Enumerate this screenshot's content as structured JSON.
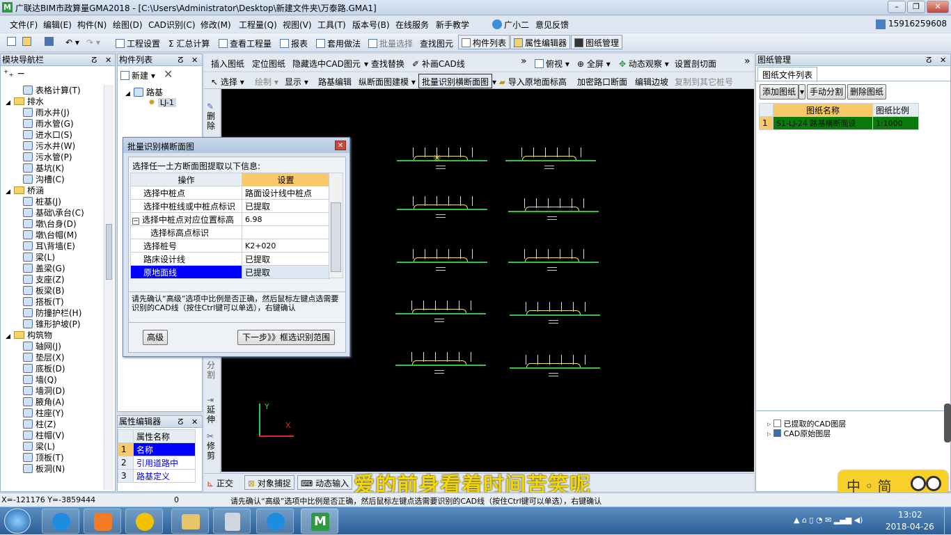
{
  "window": {
    "title": "广联达BIM市政算量GMA2018 - [C:\\Users\\Administrator\\Desktop\\新建文件夹\\万泰路.GMA1]",
    "min": "–",
    "restore": "❐",
    "close": "✕"
  },
  "menu": [
    "文件(F)",
    "编辑(E)",
    "构件(N)",
    "绘图(D)",
    "CAD识别(C)",
    "修改(M)",
    "工程量(Q)",
    "视图(V)",
    "工具(T)",
    "版本号(B)",
    "在线服务",
    "新手教学",
    "广小二",
    "意见反馈"
  ],
  "phone": "15916259608",
  "toolbar1": [
    "工程设置",
    "Σ 汇总计算",
    "查看工程量",
    "报表",
    "套用做法",
    "批量选择",
    "查找图元"
  ],
  "toggles": [
    "构件列表",
    "属性编辑器",
    "图纸管理"
  ],
  "nav_panel": {
    "title": "模块导航栏",
    "items": [
      {
        "label": "表格计算(T)",
        "level": 2
      },
      {
        "label": "排水",
        "level": 1,
        "folder": true
      },
      {
        "label": "雨水井(J)",
        "level": 2
      },
      {
        "label": "雨水管(G)",
        "level": 2
      },
      {
        "label": "进水口(S)",
        "level": 2
      },
      {
        "label": "污水井(W)",
        "level": 2
      },
      {
        "label": "污水管(P)",
        "level": 2
      },
      {
        "label": "基坑(K)",
        "level": 2
      },
      {
        "label": "沟槽(C)",
        "level": 2
      },
      {
        "label": "桥涵",
        "level": 1,
        "folder": true
      },
      {
        "label": "桩基(J)",
        "level": 2
      },
      {
        "label": "基础\\承台(C)",
        "level": 2
      },
      {
        "label": "墩\\台身(D)",
        "level": 2
      },
      {
        "label": "墩\\台帽(M)",
        "level": 2
      },
      {
        "label": "耳\\背墙(E)",
        "level": 2
      },
      {
        "label": "梁(L)",
        "level": 2
      },
      {
        "label": "盖梁(G)",
        "level": 2
      },
      {
        "label": "支座(Z)",
        "level": 2
      },
      {
        "label": "板梁(B)",
        "level": 2
      },
      {
        "label": "搭板(T)",
        "level": 2
      },
      {
        "label": "防撞护栏(H)",
        "level": 2
      },
      {
        "label": "锥形护坡(P)",
        "level": 2
      },
      {
        "label": "构筑物",
        "level": 1,
        "folder": true
      },
      {
        "label": "轴网(J)",
        "level": 2
      },
      {
        "label": "垫层(X)",
        "level": 2
      },
      {
        "label": "底板(D)",
        "level": 2
      },
      {
        "label": "墙(Q)",
        "level": 2
      },
      {
        "label": "墙洞(D)",
        "level": 2
      },
      {
        "label": "腋角(A)",
        "level": 2
      },
      {
        "label": "柱座(Y)",
        "level": 2
      },
      {
        "label": "柱(Z)",
        "level": 2
      },
      {
        "label": "柱帽(V)",
        "level": 2
      },
      {
        "label": "梁(L)",
        "level": 2
      },
      {
        "label": "顶板(T)",
        "level": 2
      },
      {
        "label": "板洞(N)",
        "level": 2
      }
    ]
  },
  "component_panel": {
    "title": "构件列表",
    "new_label": "新建",
    "tree_root": "路基",
    "tree_child": "LJ-1"
  },
  "attr_panel": {
    "title": "属性编辑器",
    "header": "属性名称",
    "rows": [
      {
        "num": "1",
        "name": "名称"
      },
      {
        "num": "2",
        "name": "引用道路中"
      },
      {
        "num": "3",
        "name": "路基定义"
      }
    ]
  },
  "side_tools": [
    "删除",
    "分割",
    "延伸",
    "修剪"
  ],
  "toolbar2": [
    "插入图纸",
    "定位图纸",
    "隐藏选中CAD图元",
    "查找替换",
    "补画CAD线",
    "俯视",
    "全屏",
    "动态观察",
    "设置剖切面"
  ],
  "toolbar3": [
    "选择",
    "绘制",
    "显示",
    "路基编辑",
    "纵断面图建模",
    "批量识别横断面图",
    "导入原地面标高",
    "加密路口断面",
    "编辑边坡",
    "复制到其它桩号"
  ],
  "dialog": {
    "title": "批量识别横断面图",
    "prompt": "选择任一土方断面图提取以下信息:",
    "col_op": "操作",
    "col_set": "设置",
    "rows": [
      {
        "op": "选择中桩点",
        "set": "路面设计线中桩点"
      },
      {
        "op": "选择中桩线或中桩点标识",
        "set": "已提取"
      },
      {
        "op": "选择中桩点对应位置标高",
        "set": "6.98"
      },
      {
        "op": "选择标高点标识",
        "set": ""
      },
      {
        "op": "选择桩号",
        "set": "K2+020"
      },
      {
        "op": "路床设计线",
        "set": "已提取"
      },
      {
        "op": "原地面线",
        "set": "已提取"
      }
    ],
    "hint": "请先确认“高级”选项中比例是否正确，然后鼠标左键点选需要识别的CAD线（按住Ctrl键可以单选），右键确认",
    "advanced": "高级",
    "next": "下一步》》框选识别范围"
  },
  "drawing_panel": {
    "title": "图纸管理",
    "tab": "图纸文件列表",
    "buttons": [
      "添加图纸",
      "手动分割",
      "删除图纸"
    ],
    "col_name": "图纸名称",
    "col_scale": "图纸比例",
    "row": {
      "num": "1",
      "name": "S1-LJ-24 路基横断面设",
      "scale": "1:1000"
    },
    "layers": [
      "已提取的CAD图层",
      "CAD原始图层"
    ]
  },
  "bottom_tabs": [
    "正交",
    "对象捕捉",
    "动态输入"
  ],
  "subtitle": "爱的前身看着时间苦笑呢",
  "status": {
    "coords": "X=-121176 Y=-3859444",
    "zero": "0",
    "message": "请先确认“高级”选项中比例是否正确，然后鼠标左键点选需要识别的CAD线（按住Ctrl键可以单选），右键确认"
  },
  "ime": {
    "label": "中 ◦ 简"
  },
  "clock": {
    "time": "13:02",
    "date": "2018-04-26"
  },
  "colors": {
    "selected_row": "#0000ff",
    "header_orange": "#f7c96a",
    "canvas": "#000000",
    "drawing_row": "#0a7a0a"
  }
}
